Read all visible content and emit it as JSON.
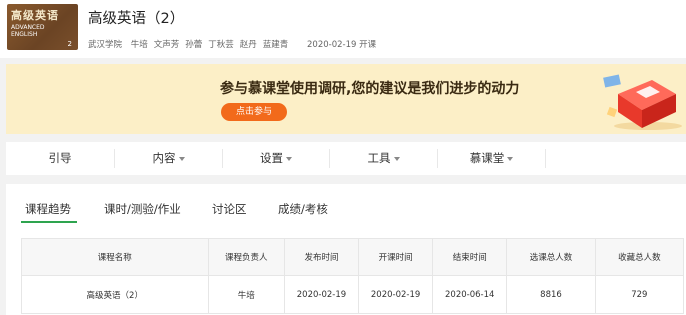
{
  "header": {
    "cover": {
      "line1": "高级英语",
      "line2": "ADVANCED",
      "line3": "ENGLISH",
      "volume": "2"
    },
    "title": "高级英语（2）",
    "school": "武汉学院",
    "teachers": [
      "牛培",
      "文声芳",
      "孙蕾",
      "丁秋芸",
      "赵丹",
      "蓝建青"
    ],
    "start_date": "2020-02-19 开课"
  },
  "banner": {
    "message": "参与慕课堂使用调研,您的建议是我们进步的动力",
    "button_label": "点击参与",
    "bg_color": "#fcefc7",
    "button_color": "#f26a1b"
  },
  "nav": {
    "items": [
      {
        "label": "引导",
        "has_dropdown": false
      },
      {
        "label": "内容",
        "has_dropdown": true
      },
      {
        "label": "设置",
        "has_dropdown": true
      },
      {
        "label": "工具",
        "has_dropdown": true
      },
      {
        "label": "慕课堂",
        "has_dropdown": true
      }
    ]
  },
  "tabs": {
    "items": [
      "课程趋势",
      "课时/测验/作业",
      "讨论区",
      "成绩/考核"
    ],
    "active_index": 0,
    "accent_color": "#2ea44f"
  },
  "table": {
    "headers": [
      "课程名称",
      "课程负责人",
      "发布时间",
      "开课时间",
      "结束时间",
      "选课总人数",
      "收藏总人数"
    ],
    "rows": [
      [
        "高级英语（2）",
        "牛培",
        "2020-02-19",
        "2020-02-19",
        "2020-06-14",
        "8816",
        "729"
      ]
    ]
  }
}
